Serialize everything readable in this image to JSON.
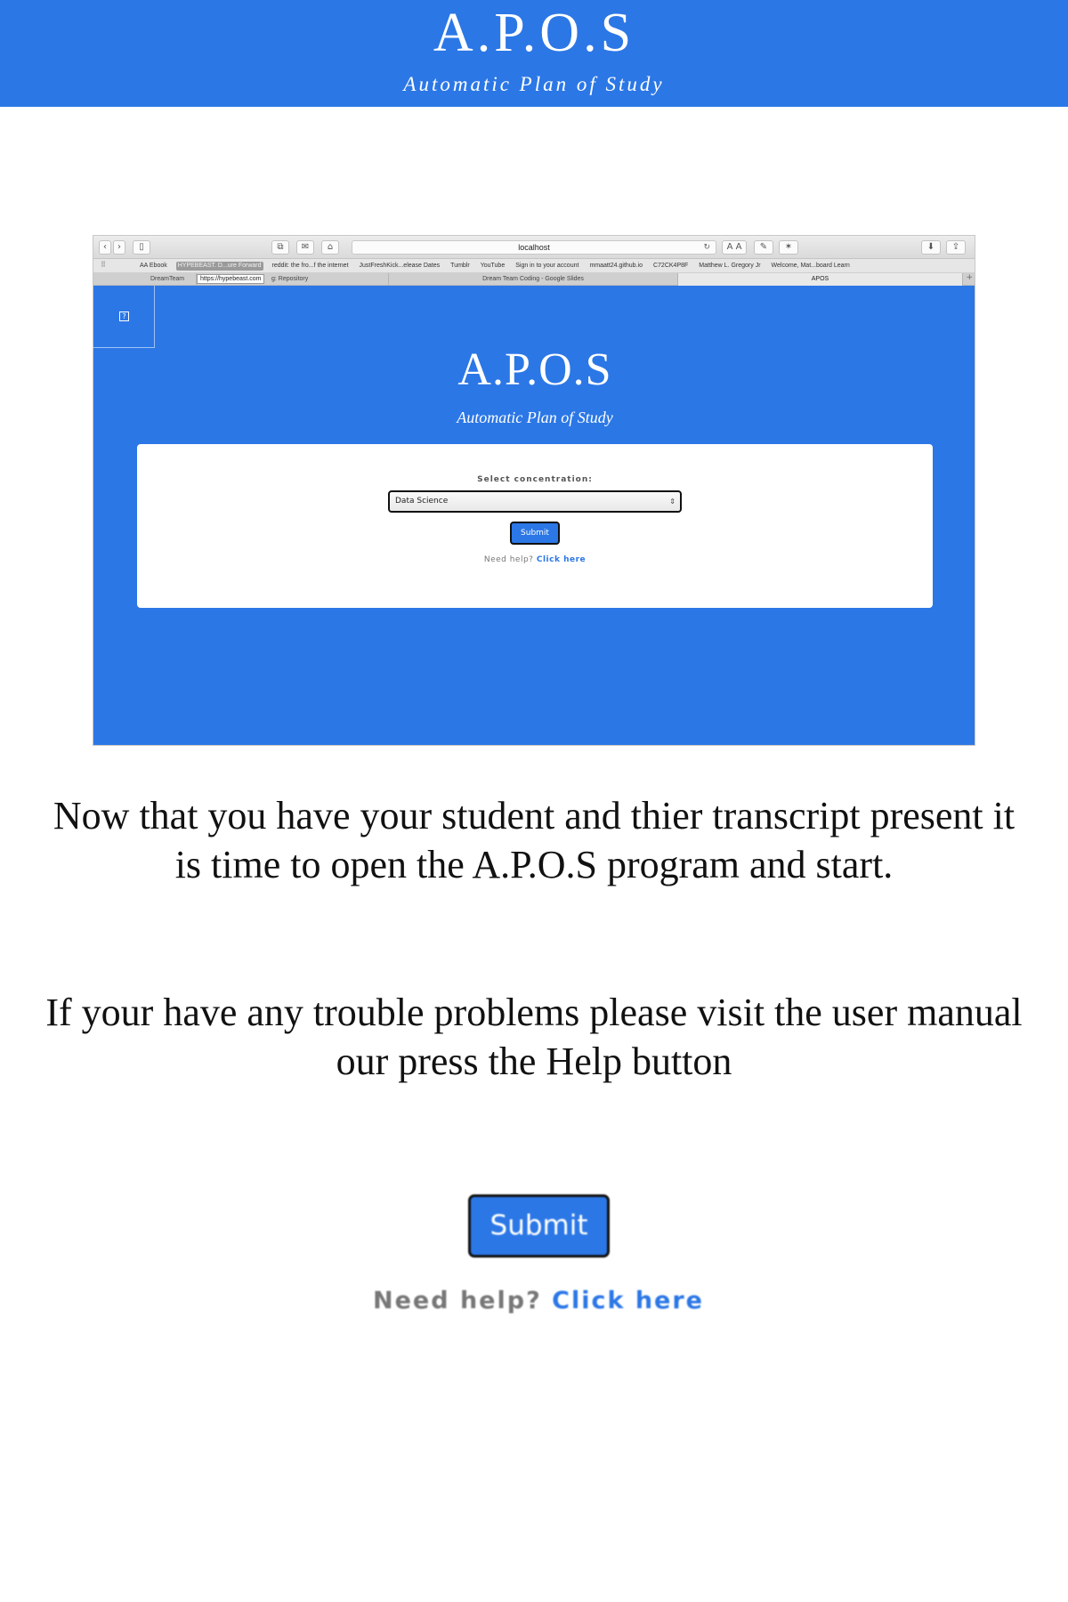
{
  "header": {
    "title": "A.P.O.S",
    "subtitle": "Automatic Plan of Study"
  },
  "screenshot": {
    "browser": {
      "url": "localhost",
      "toolbar_buttons": [
        "back",
        "forward",
        "sidebar",
        "tabs-overview",
        "share",
        "home"
      ],
      "toolbar_right": [
        "text-size",
        "annotate",
        "brightness",
        "download",
        "share"
      ],
      "text_size_label": "A A",
      "bookmarks": [
        "AA Ebook",
        "HYPEBEAST. D...ure Forward",
        "reddit: the fro...f the internet",
        "JustFreshKick...elease Dates",
        "Tumblr",
        "YouTube",
        "Sign in to your account",
        "mmaatt24.github.io",
        "C72CK4P8F",
        "Matthew L. Gregory Jr",
        "Welcome, Mat...board Learn"
      ],
      "active_bookmark_index": 1,
      "tabs": [
        {
          "label": "DreamTeam",
          "active": false
        },
        {
          "label": "g: Repository",
          "active": false
        },
        {
          "label": "Dream Team Coding - Google Slides",
          "active": false
        },
        {
          "label": "APOS",
          "active": true
        }
      ],
      "tooltip": "https://hypebeast.com"
    },
    "app": {
      "help_icon": "question-icon",
      "title": "A.P.O.S",
      "subtitle": "Automatic Plan of Study",
      "select_label": "Select concentration:",
      "select_value": "Data Science",
      "submit_label": "Submit",
      "help_text": "Need help?",
      "help_link": "Click here"
    }
  },
  "instructions": {
    "paragraph_1": "Now that you have your student and thier transcript present it is time to open the A.P.O.S program and start.",
    "paragraph_2": "If your have any trouble problems please visit the user manual our press the Help button"
  },
  "zoom": {
    "submit_label": "Submit",
    "help_text": "Need help?",
    "help_link": "Click here"
  },
  "colors": {
    "accent": "#2b77e6",
    "link": "#2b77e6",
    "text": "#111111"
  }
}
